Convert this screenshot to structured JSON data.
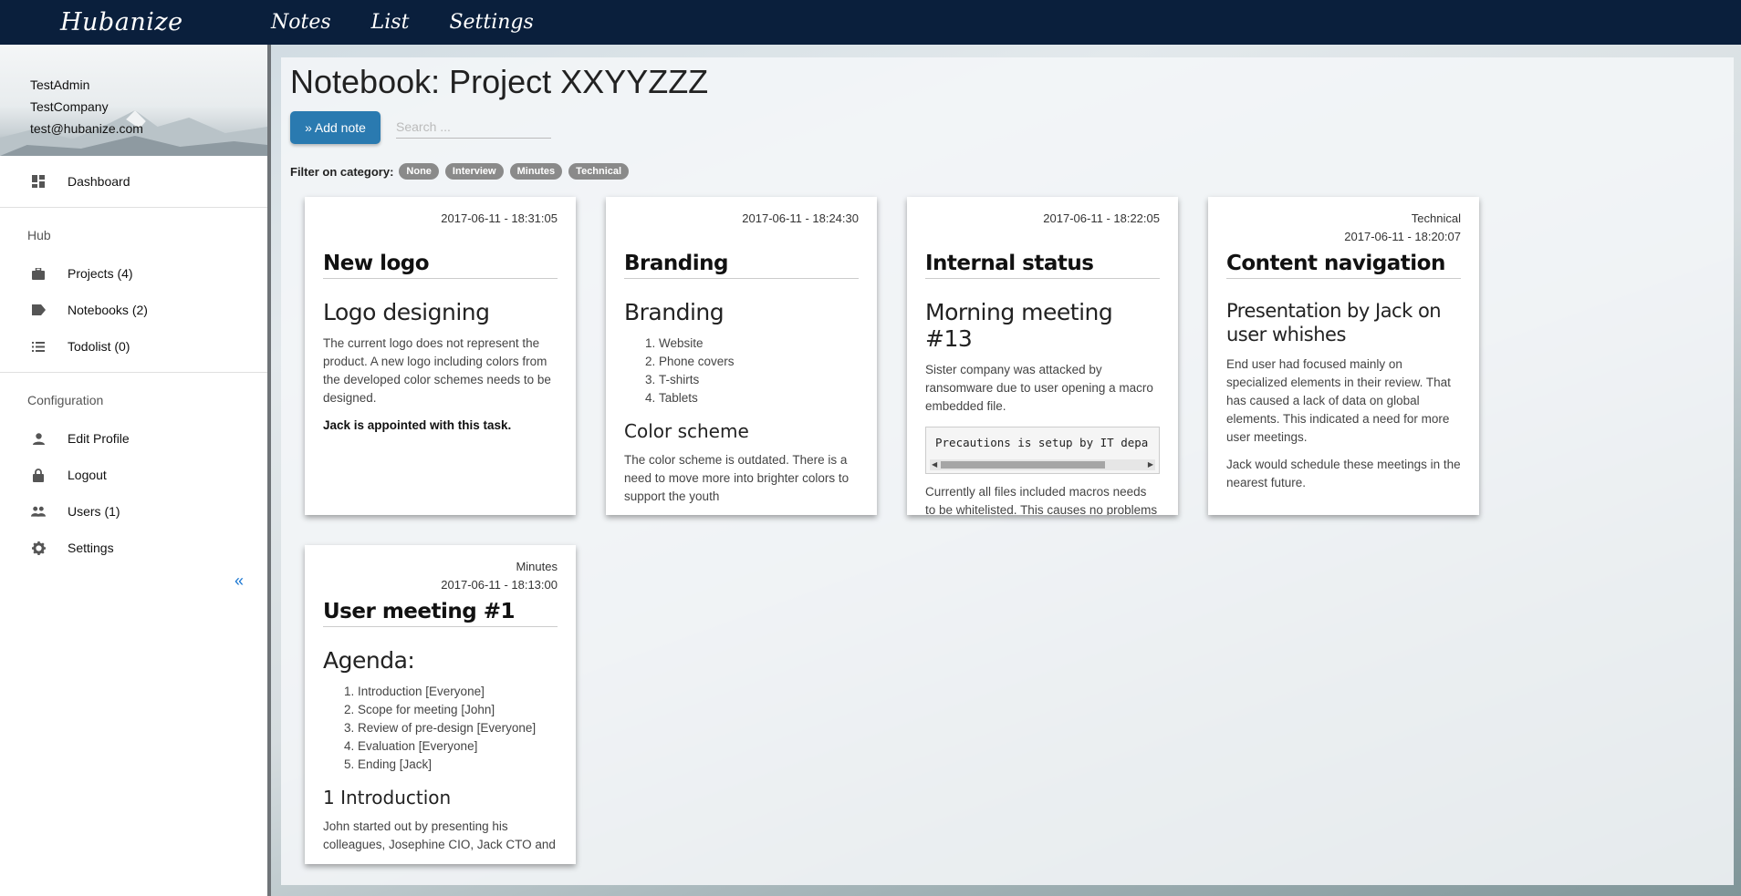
{
  "topbar": {
    "brand": "Hubanize",
    "nav": [
      "Notes",
      "List",
      "Settings"
    ]
  },
  "sidebar": {
    "profile": {
      "name": "TestAdmin",
      "company": "TestCompany",
      "email": "test@hubanize.com"
    },
    "dashboard": {
      "label": "Dashboard",
      "icon": "dashboard-icon"
    },
    "hub_label": "Hub",
    "hub_items": [
      {
        "label": "Projects (4)",
        "icon": "briefcase-icon"
      },
      {
        "label": "Notebooks (2)",
        "icon": "label-icon"
      },
      {
        "label": "Todolist (0)",
        "icon": "list-icon"
      }
    ],
    "config_label": "Configuration",
    "config_items": [
      {
        "label": "Edit Profile",
        "icon": "person-icon"
      },
      {
        "label": "Logout",
        "icon": "lock-icon"
      },
      {
        "label": "Users (1)",
        "icon": "people-icon"
      },
      {
        "label": "Settings",
        "icon": "gear-icon"
      }
    ],
    "collapse_glyph": "«"
  },
  "main": {
    "title": "Notebook: Project XXYYZZZ",
    "add_note": "Add note",
    "search_placeholder": "Search ...",
    "filter_label": "Filter on category:",
    "categories": [
      "None",
      "Interview",
      "Minutes",
      "Technical"
    ]
  },
  "cards": [
    {
      "category": "",
      "timestamp": "2017-06-11 - 18:31:05",
      "title": "New logo",
      "heading": "Logo designing",
      "body": "The current logo does not represent the product. A new logo including colors from the developed color schemes needs to be designed.",
      "bold": "Jack is appointed with this task."
    },
    {
      "category": "",
      "timestamp": "2017-06-11 - 18:24:30",
      "title": "Branding",
      "heading": "Branding",
      "list": [
        "Website",
        "Phone covers",
        "T-shirts",
        "Tablets"
      ],
      "subheading": "Color scheme",
      "body": "The color scheme is outdated. There is a need to move more into brighter colors to support the youth"
    },
    {
      "category": "",
      "timestamp": "2017-06-11 - 18:22:05",
      "title": "Internal status",
      "heading": "Morning meeting #13",
      "body": "Sister company was attacked by ransomware due to user opening a macro embedded file.",
      "code": "Precautions is setup by IT depa",
      "body2": "Currently all files included macros needs to be whitelisted. This causes no problems with the implementation plan"
    },
    {
      "category": "Technical",
      "timestamp": "2017-06-11 - 18:20:07",
      "title": "Content navigation",
      "heading": "Presentation by Jack on user whishes",
      "body": "End user had focused mainly on specialized elements in their review. That has caused a lack of data on global elements. This indicated a need for more user meetings.",
      "body2": "Jack would schedule these meetings in the nearest future."
    },
    {
      "category": "Minutes",
      "timestamp": "2017-06-11 - 18:13:00",
      "title": "User meeting #1",
      "heading": "Agenda:",
      "list": [
        "Introduction [Everyone]",
        "Scope for meeting [John]",
        "Review of pre-design [Everyone]",
        "Evaluation [Everyone]",
        "Ending [Jack]"
      ],
      "subheading": "1 Introduction",
      "body": "John started out by presenting his colleagues, Josephine CIO, Jack CTO and"
    }
  ]
}
